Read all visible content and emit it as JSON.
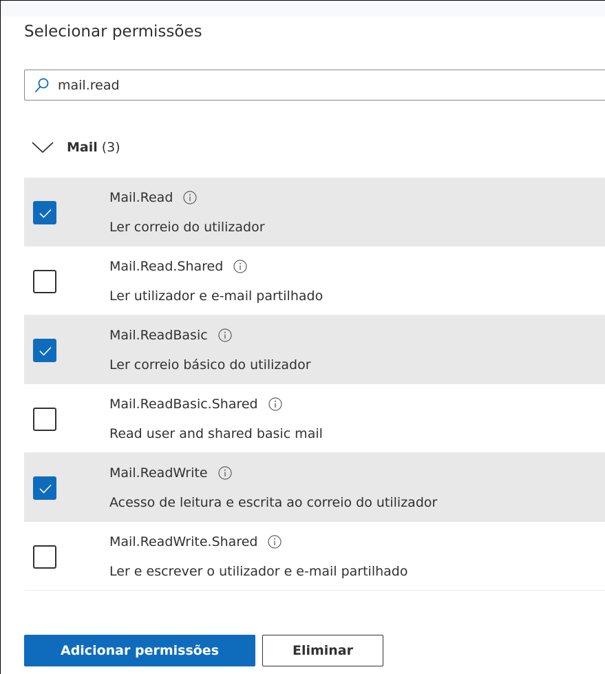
{
  "panel": {
    "title": "Selecionar permissões"
  },
  "search": {
    "value": "mail.read",
    "icon": "search-icon"
  },
  "group": {
    "name": "Mail",
    "count": "(3)",
    "expanded": true,
    "icon": "chevron-down-icon"
  },
  "permissions": [
    {
      "name": "Mail.Read",
      "description": "Ler correio do utilizador",
      "checked": true
    },
    {
      "name": "Mail.Read.Shared",
      "description": "Ler utilizador e e-mail partilhado",
      "checked": false
    },
    {
      "name": "Mail.ReadBasic",
      "description": "Ler correio básico do utilizador",
      "checked": true
    },
    {
      "name": "Mail.ReadBasic.Shared",
      "description": "Read user and shared basic mail",
      "checked": false
    },
    {
      "name": "Mail.ReadWrite",
      "description": "Acesso de leitura e escrita ao correio do utilizador",
      "checked": true
    },
    {
      "name": "Mail.ReadWrite.Shared",
      "description": "Ler e escrever o utilizador e e-mail partilhado",
      "checked": false
    }
  ],
  "actions": {
    "add_label": "Adicionar permissões",
    "discard_label": "Eliminar"
  },
  "colors": {
    "accent": "#0f6cbd",
    "selected_row": "#e8e8e8",
    "text": "#323130"
  }
}
